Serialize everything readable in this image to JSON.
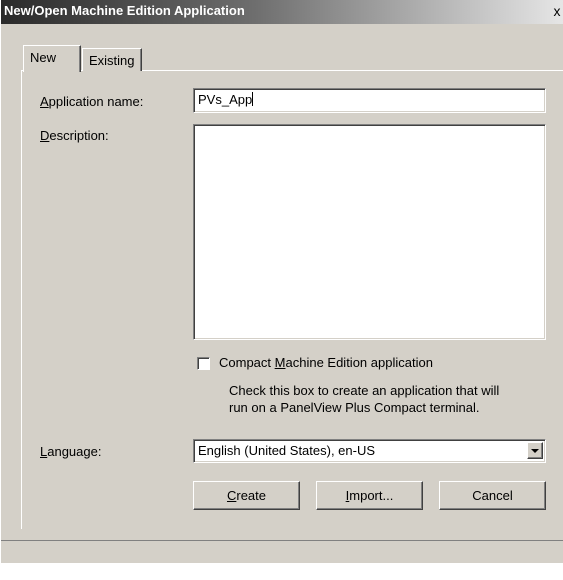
{
  "window": {
    "title": "New/Open Machine Edition Application",
    "close_glyph": "x"
  },
  "tabs": [
    {
      "label": "New",
      "active": true
    },
    {
      "label": "Existing",
      "active": false
    }
  ],
  "form": {
    "app_name_label_mnemonic": "A",
    "app_name_label_rest": "pplication name:",
    "app_name_value": "PVs_App",
    "description_label_mnemonic": "D",
    "description_label_rest": "escription:",
    "description_value": "",
    "compact_checkbox_label_pre": "Compact ",
    "compact_checkbox_label_mnemonic": "M",
    "compact_checkbox_label_post": "achine Edition application",
    "compact_checked": false,
    "compact_help_line1": "Check this box to create an application that will",
    "compact_help_line2": "run on a PanelView Plus Compact terminal.",
    "language_label_mnemonic": "L",
    "language_label_rest": "anguage:",
    "language_value": "English (United States), en-US"
  },
  "buttons": {
    "create_mnemonic": "C",
    "create_rest": "reate",
    "import_mnemonic": "I",
    "import_rest": "mport...",
    "cancel": "Cancel"
  }
}
